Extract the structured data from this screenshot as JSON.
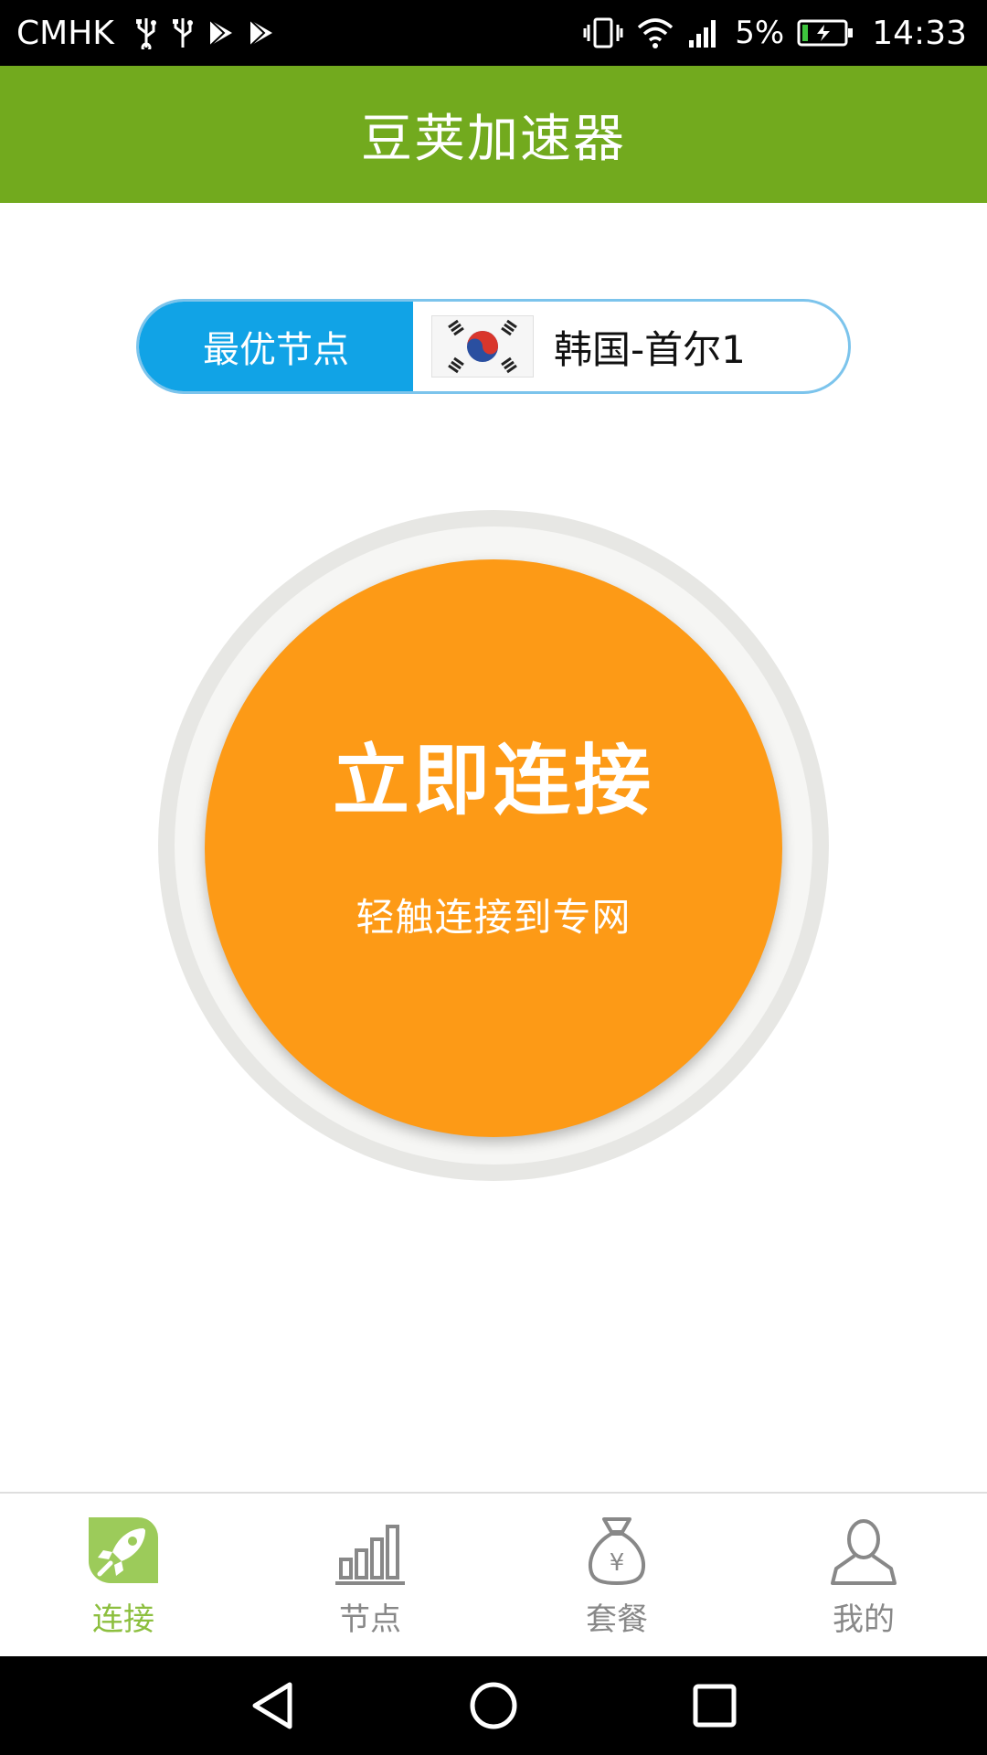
{
  "status_bar": {
    "carrier": "CMHK",
    "battery_percent": "5%",
    "time": "14:33",
    "icons": [
      "usb-icon",
      "usb-icon",
      "play-store-icon",
      "play-store-icon",
      "vibrate-icon",
      "wifi-icon",
      "signal-icon",
      "battery-charging-icon"
    ]
  },
  "header": {
    "title": "豆荚加速器"
  },
  "node_selector": {
    "label": "最优节点",
    "flag_icon": "south-korea-flag-icon",
    "selected_node": "韩国-首尔1"
  },
  "connect": {
    "title": "立即连接",
    "subtitle": "轻触连接到专网"
  },
  "tabs": [
    {
      "label": "连接",
      "icon": "rocket-icon",
      "active": true
    },
    {
      "label": "节点",
      "icon": "bar-chart-icon",
      "active": false
    },
    {
      "label": "套餐",
      "icon": "money-bag-icon",
      "active": false
    },
    {
      "label": "我的",
      "icon": "user-icon",
      "active": false
    }
  ],
  "nav_bar": {
    "icons": [
      "back-icon",
      "home-icon",
      "recents-icon"
    ]
  },
  "colors": {
    "header_green": "#72aa1e",
    "node_blue": "#11a3e6",
    "connect_orange": "#fd9a16",
    "tab_active": "#8dbf3f",
    "tab_inactive": "#888888"
  }
}
